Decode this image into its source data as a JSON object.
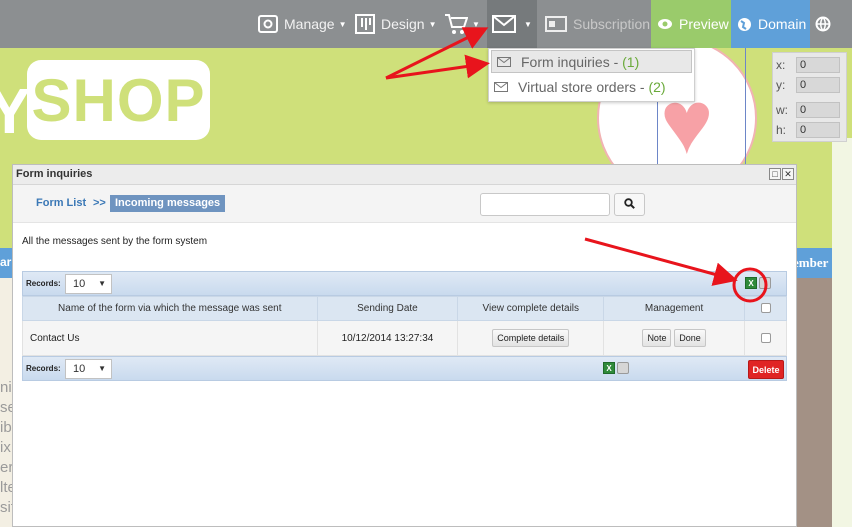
{
  "toolbar": {
    "manage_label": "Manage",
    "design_label": "Design",
    "subscription_label": "Subscription",
    "preview_label": "Preview",
    "domain_label": "Domain"
  },
  "mail_menu": {
    "items": [
      {
        "label": "Form inquiries - ",
        "count": "(1)"
      },
      {
        "label": "Virtual store orders - ",
        "count": "(2)"
      }
    ]
  },
  "coords": {
    "x_label": "x:",
    "x_value": "0",
    "y_label": "y:",
    "y_value": "0",
    "w_label": "w:",
    "w_value": "0",
    "h_label": "h:",
    "h_value": "0"
  },
  "site": {
    "logo_text": "SHOP",
    "logo_prefix": "Y",
    "band_left": "ar",
    "band_right": "ember",
    "side_text": [
      "ni",
      "se",
      "ib",
      "ix",
      "er",
      "lte",
      "sit"
    ]
  },
  "modal": {
    "title": "Form inquiries",
    "breadcrumb": {
      "root": "Form List",
      "separator": ">>",
      "current": "Incoming messages"
    },
    "search": {
      "value": ""
    },
    "description": "All the messages sent by the form system",
    "records_label": "Records:",
    "records_value": "10",
    "columns": {
      "name": "Name of the form via which the message was sent",
      "date": "Sending Date",
      "view": "View complete details",
      "management": "Management"
    },
    "rows": [
      {
        "name": "Contact Us",
        "date": "10/12/2014 13:27:34",
        "details_label": "Complete details",
        "note_label": "Note",
        "done_label": "Done"
      }
    ],
    "delete_label": "Delete",
    "xls_glyph": "X"
  },
  "colors": {
    "toolbar_bg": "#8c8f91",
    "preview_bg": "#9acb6b",
    "domain_bg": "#5fa0d9",
    "site_green": "#cfe07a",
    "annotation_red": "#e8141c",
    "delete_red": "#e02424"
  }
}
